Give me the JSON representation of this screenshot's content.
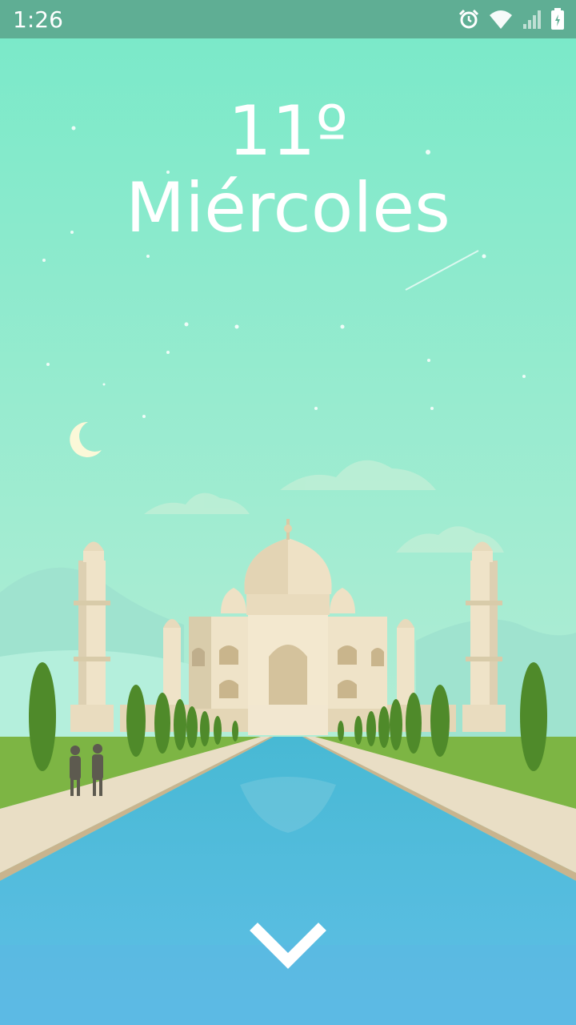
{
  "status_bar": {
    "time": "1:26",
    "icons": [
      "alarm-icon",
      "wifi-icon",
      "signal-icon",
      "battery-icon"
    ]
  },
  "weather": {
    "temperature": "11º",
    "day": "Miércoles"
  },
  "scene": {
    "subject": "taj-mahal-illustration",
    "colors": {
      "sky_top": "#7ce8c8",
      "sky_bottom": "#a8ecd0",
      "water": "#4fc0dc",
      "grass": "#79b43f",
      "path": "#eadfc6",
      "building": "#eee0c4"
    }
  },
  "controls": {
    "next_icon": "chevron-down-icon"
  }
}
